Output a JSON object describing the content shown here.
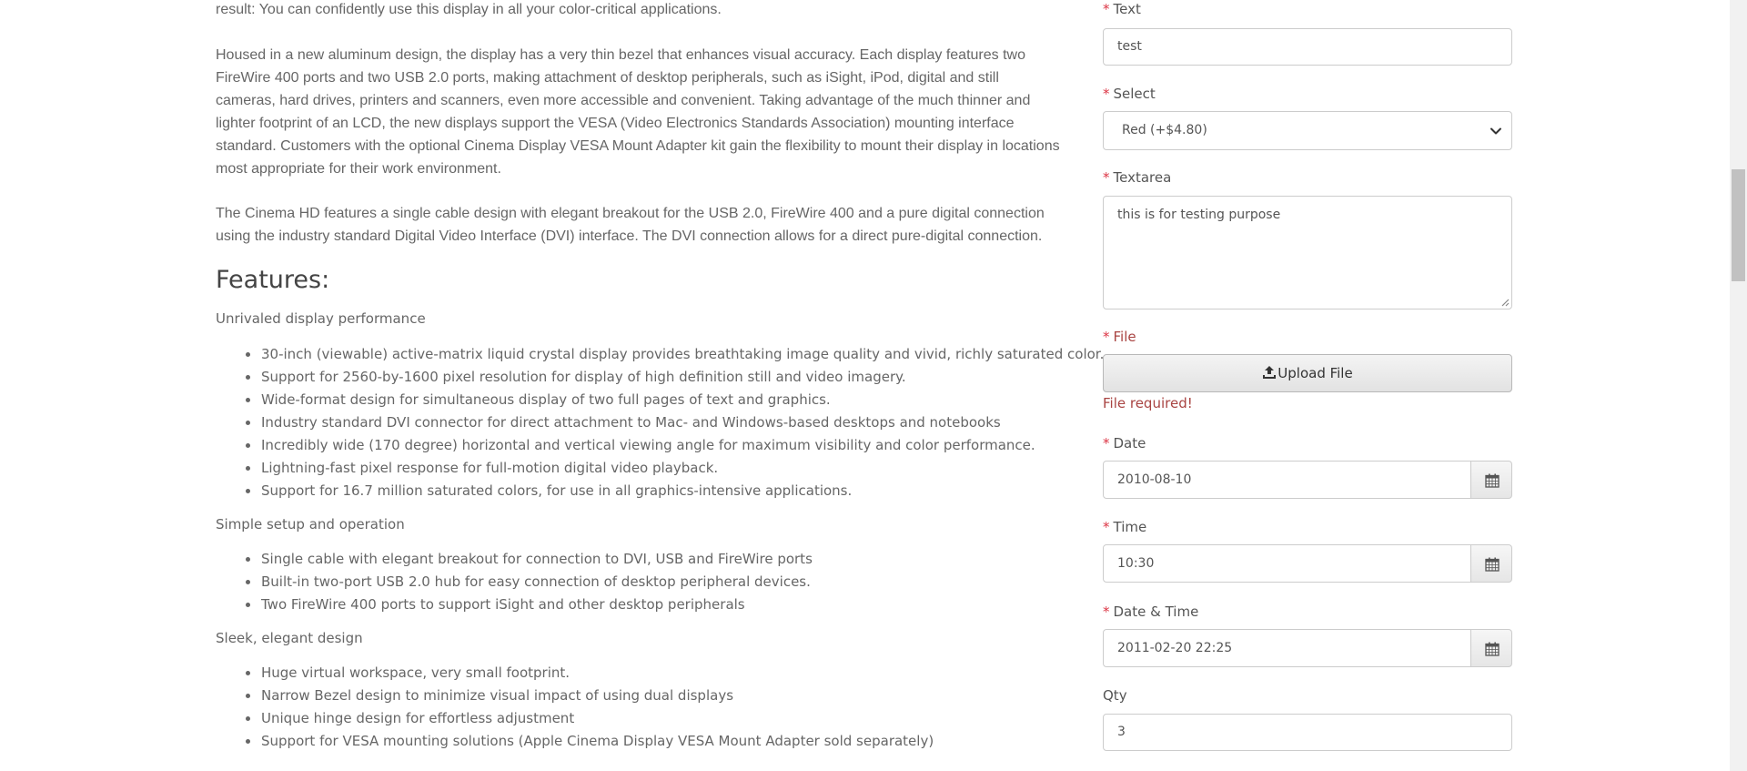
{
  "description": {
    "paragraphs": [
      "result: You can confidently use this display in all your color-critical applications.",
      "Housed in a new aluminum design, the display has a very thin bezel that enhances visual accuracy. Each display features two FireWire 400 ports and two USB 2.0 ports, making attachment of desktop peripherals, such as iSight, iPod, digital and still cameras, hard drives, printers and scanners, even more accessible and convenient. Taking advantage of the much thinner and lighter footprint of an LCD, the new displays support the VESA (Video Electronics Standards Association) mounting interface standard. Customers with the optional Cinema Display VESA Mount Adapter kit gain the flexibility to mount their display in locations most appropriate for their work environment.",
      "The Cinema HD features a single cable design with elegant breakout for the USB 2.0, FireWire 400 and a pure digital connection using the industry standard Digital Video Interface (DVI) interface. The DVI connection allows for a direct pure-digital connection."
    ],
    "features_heading": "Features:",
    "groups": [
      {
        "title": "Unrivaled display performance",
        "items": [
          "30-inch (viewable) active-matrix liquid crystal display provides breathtaking image quality and vivid, richly saturated color.",
          "Support for 2560-by-1600 pixel resolution for display of high definition still and video imagery.",
          "Wide-format design for simultaneous display of two full pages of text and graphics.",
          "Industry standard DVI connector for direct attachment to Mac- and Windows-based desktops and notebooks",
          "Incredibly wide (170 degree) horizontal and vertical viewing angle for maximum visibility and color performance.",
          "Lightning-fast pixel response for full-motion digital video playback.",
          "Support for 16.7 million saturated colors, for use in all graphics-intensive applications."
        ]
      },
      {
        "title": "Simple setup and operation",
        "items": [
          "Single cable with elegant breakout for connection to DVI, USB and FireWire ports",
          "Built-in two-port USB 2.0 hub for easy connection of desktop peripheral devices.",
          "Two FireWire 400 ports to support iSight and other desktop peripherals"
        ]
      },
      {
        "title": "Sleek, elegant design",
        "items": [
          "Huge virtual workspace, very small footprint.",
          "Narrow Bezel design to minimize visual impact of using dual displays",
          "Unique hinge design for effortless adjustment",
          "Support for VESA mounting solutions (Apple Cinema Display VESA Mount Adapter sold separately)"
        ]
      }
    ]
  },
  "options": {
    "required_mark": "*",
    "text": {
      "label": "Text",
      "value": "test"
    },
    "select": {
      "label": "Select",
      "value": "Red (+$4.80)"
    },
    "textarea": {
      "label": "Textarea",
      "value": "this is for testing purpose"
    },
    "file": {
      "label": "File",
      "button_label": "Upload File",
      "error": "File required!"
    },
    "date": {
      "label": "Date",
      "value": "2010-08-10"
    },
    "time": {
      "label": "Time",
      "value": "10:30"
    },
    "datetime": {
      "label": "Date & Time",
      "value": "2011-02-20 22:25"
    },
    "qty": {
      "label": "Qty",
      "value": "3"
    }
  },
  "icons": {
    "upload": "upload-icon",
    "calendar": "calendar-icon",
    "chevron": "chevron-down-icon",
    "resize": "resize-grip-icon"
  },
  "colors": {
    "required": "#dc3545",
    "error": "#a94442",
    "body_text": "#666666"
  }
}
